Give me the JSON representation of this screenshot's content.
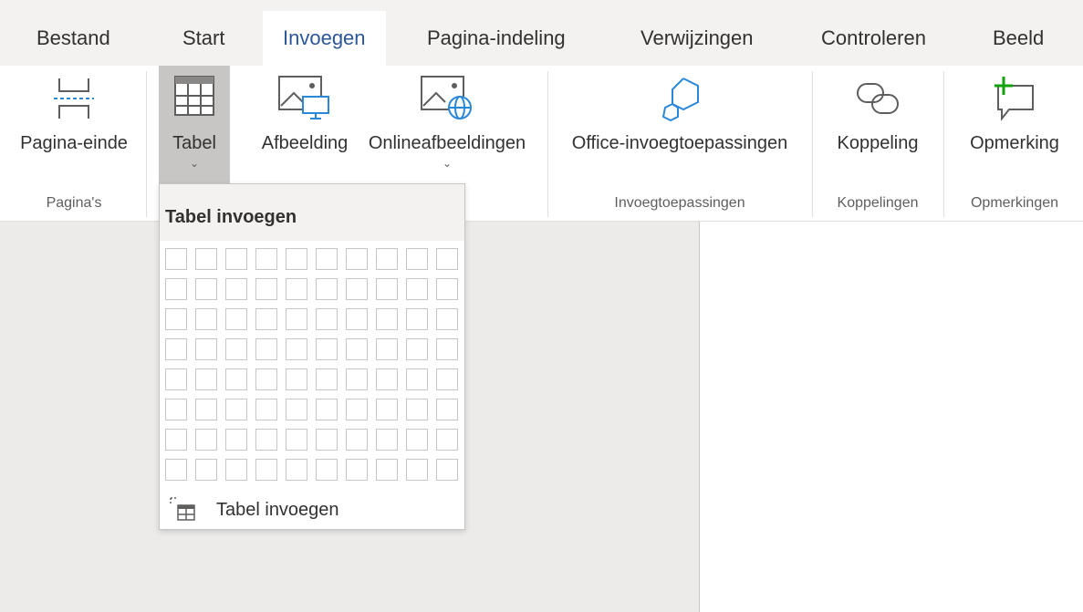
{
  "tabs": [
    "Bestand",
    "Start",
    "Invoegen",
    "Pagina-indeling",
    "Verwijzingen",
    "Controleren",
    "Beeld"
  ],
  "active_tab": "Invoegen",
  "ribbon": {
    "page_break": "Pagina-einde",
    "table": "Tabel",
    "picture": "Afbeelding",
    "online_pictures": "Onlineafbeeldingen",
    "office_addins": "Office-invoegtoepassingen",
    "link": "Koppeling",
    "comment": "Opmerking",
    "groups": {
      "pages": "Pagina's",
      "addins": "Invoegtoepassingen",
      "links": "Koppelingen",
      "comments": "Opmerkingen"
    }
  },
  "dropdown": {
    "header": "Tabel invoegen",
    "grid": {
      "columns": 10,
      "rows": 8
    },
    "insert_item": "Tabel invoegen"
  },
  "colors": {
    "accent": "#2b579a",
    "icon_blue": "#2b88d8",
    "plus_green": "#13a10e",
    "doc_background": "#edebe9"
  }
}
